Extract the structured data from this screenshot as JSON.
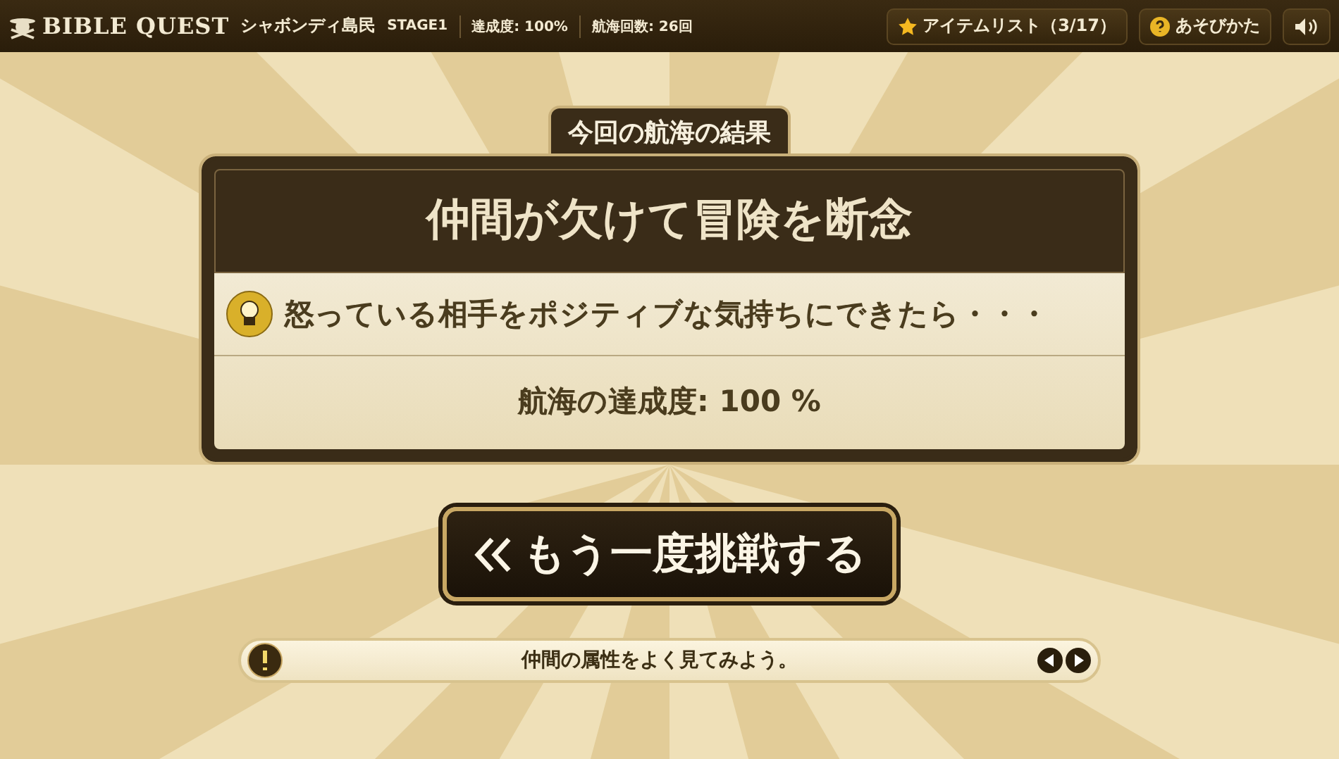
{
  "header": {
    "logo": "BIBLE QUEST",
    "location": "シャボンディ島民",
    "stage": "STAGE1",
    "progress": "達成度: 100%",
    "voyages": "航海回数: 26回",
    "buttons": [
      {
        "kind": "items",
        "label": "アイテムリスト（3/17）"
      },
      {
        "kind": "help",
        "label": "あそびかた"
      },
      {
        "kind": "sound"
      }
    ]
  },
  "result": {
    "title": "今回の航海の結果",
    "heading": "仲間が欠けて冒険を断念",
    "hint": "怒っている相手をポジティブな気持ちにできたら・・・",
    "achievement": "航海の達成度: 100 %"
  },
  "retry_button": {
    "label": "もう一度挑戦する"
  },
  "tip": {
    "text": "仲間の属性をよく見てみよう。"
  }
}
